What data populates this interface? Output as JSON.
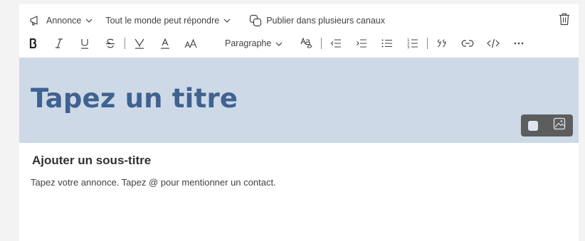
{
  "toolbar_top": {
    "post_type": "Annonce",
    "reply_setting": "Tout le monde peut répondre",
    "multi_channel": "Publier dans plusieurs canaux"
  },
  "format_toolbar": {
    "paragraph_style": "Paragraphe"
  },
  "banner": {
    "title_placeholder": "Tapez un titre",
    "color": "#cdd9e7",
    "title_color": "#3f6290"
  },
  "content": {
    "subtitle_placeholder": "Ajouter un sous-titre",
    "body_placeholder": "Tapez votre annonce. Tapez @ pour mentionner un contact."
  },
  "icons": [
    "megaphone-icon",
    "chevron-down-icon",
    "multi-channel-icon",
    "trash-icon",
    "bold-icon",
    "italic-icon",
    "underline-icon",
    "strikethrough-icon",
    "highlight-icon",
    "font-color-icon",
    "font-size-icon",
    "format-paint-icon",
    "outdent-icon",
    "indent-icon",
    "bulleted-list-icon",
    "numbered-list-icon",
    "quote-icon",
    "link-icon",
    "code-icon",
    "more-icon",
    "image-icon"
  ]
}
